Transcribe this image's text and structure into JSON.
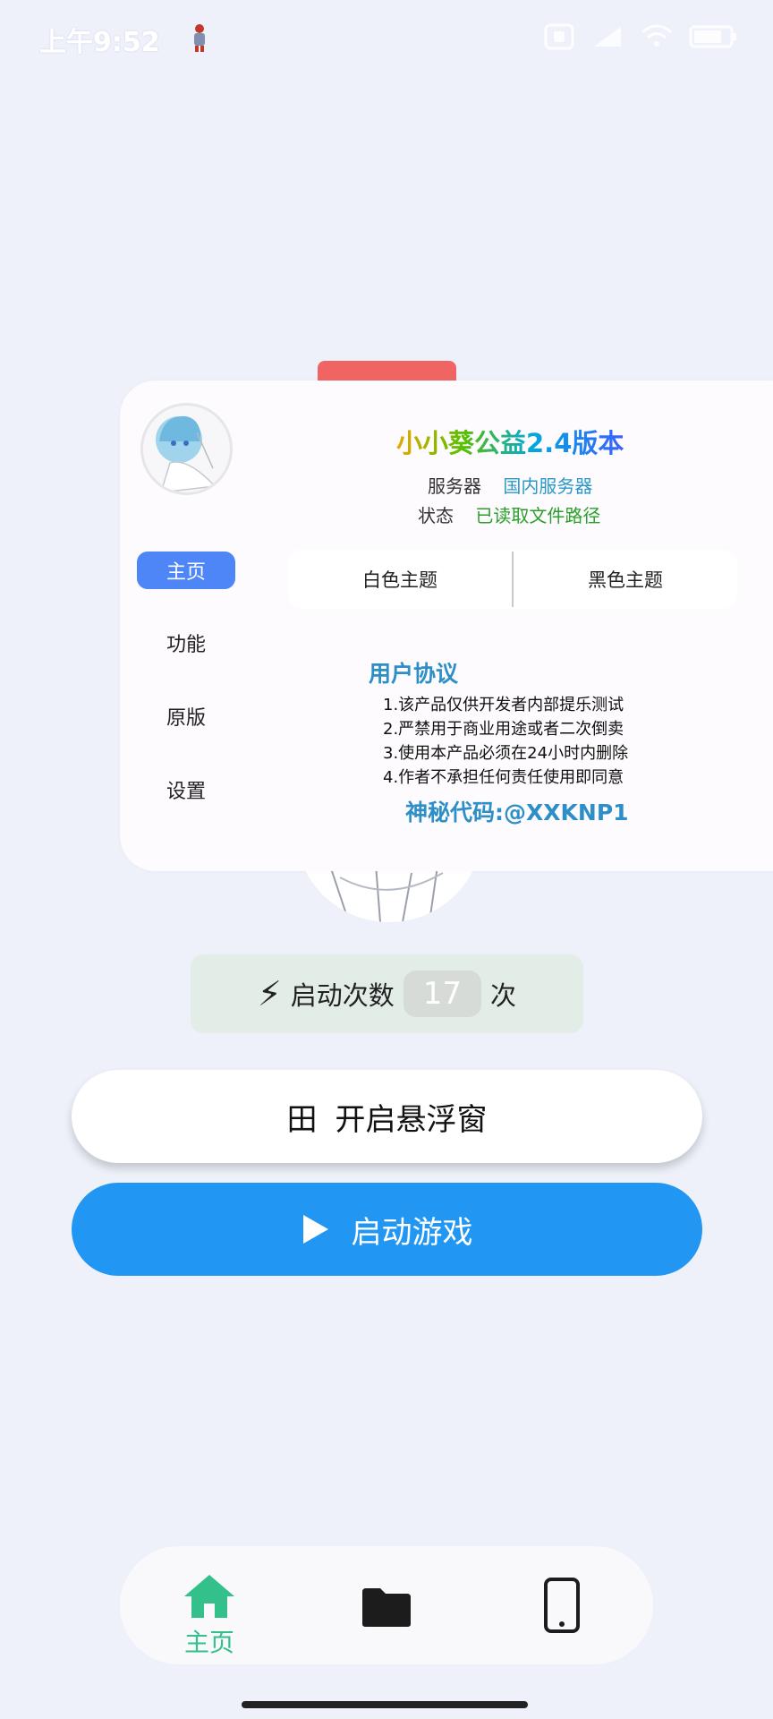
{
  "status_bar": {
    "time": "上午9:52",
    "battery": ""
  },
  "app": {
    "title": "小小葵公益2.4版本",
    "server_label": "服务器",
    "server_value": "国内服务器",
    "status_label": "状态",
    "status_value": "已读取文件路径"
  },
  "side_nav": [
    {
      "label": "主页",
      "active": true
    },
    {
      "label": "功能",
      "active": false
    },
    {
      "label": "原版",
      "active": false
    },
    {
      "label": "设置",
      "active": false
    }
  ],
  "theme": {
    "light": "白色主题",
    "dark": "黑色主题"
  },
  "agreement": {
    "title": "用户协议",
    "lines": [
      "1.该产品仅供开发者内部提乐测试",
      "2.严禁用于商业用途或者二次倒卖",
      "3.使用本产品必须在24小时内删除",
      "4.作者不承担任何责任使用即同意"
    ],
    "secret_code": "神秘代码:@XXKNP1"
  },
  "counter": {
    "prefix": "启动次数",
    "count": "17",
    "suffix": "次",
    "icon": "lightning-icon"
  },
  "buttons": {
    "float_icon": "田",
    "float_label": "开启悬浮窗",
    "start_label": "启动游戏"
  },
  "bottom_nav": {
    "home_label": "主页"
  },
  "colors": {
    "accent": "#2196f3",
    "nav_active": "#33c08a",
    "side_active": "#4f86f7"
  }
}
